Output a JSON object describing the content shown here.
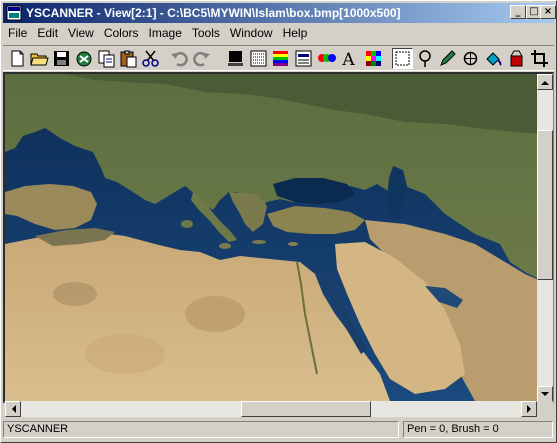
{
  "window": {
    "title": "YSCANNER - View[2:1] - C:\\BC5\\MYWIN\\Islam\\box.bmp[1000x500]",
    "app_icon": "app-icon",
    "controls": {
      "minimize": "_",
      "maximize": "□",
      "close": "×"
    }
  },
  "menu": {
    "items": [
      {
        "label": "File"
      },
      {
        "label": "Edit"
      },
      {
        "label": "View"
      },
      {
        "label": "Colors"
      },
      {
        "label": "Image"
      },
      {
        "label": "Tools"
      },
      {
        "label": "Window"
      },
      {
        "label": "Help"
      }
    ]
  },
  "toolbar": {
    "buttons": [
      {
        "name": "new-file-icon"
      },
      {
        "name": "open-folder-icon"
      },
      {
        "name": "save-disk-icon"
      },
      {
        "name": "scan-icon"
      },
      {
        "name": "copy-icon"
      },
      {
        "name": "paste-icon"
      },
      {
        "name": "cut-icon"
      },
      {
        "name": "undo-icon"
      },
      {
        "name": "redo-icon"
      },
      {
        "name": "display-icon"
      },
      {
        "name": "histogram-icon"
      },
      {
        "name": "palette-bars-icon"
      },
      {
        "name": "filter-icon"
      },
      {
        "name": "rgb-icon"
      },
      {
        "name": "text-icon",
        "text": "A"
      },
      {
        "name": "grid-colors-icon"
      },
      {
        "name": "select-rect-icon"
      },
      {
        "name": "lasso-icon"
      },
      {
        "name": "pencil-icon"
      },
      {
        "name": "circle-icon"
      },
      {
        "name": "fill-bucket-icon"
      },
      {
        "name": "paint-can-icon"
      },
      {
        "name": "crop-icon"
      }
    ]
  },
  "view": {
    "image_name": "box.bmp",
    "zoom": "2:1",
    "image_size": "1000x500"
  },
  "statusbar": {
    "app_label": "YSCANNER",
    "pen_brush": "Pen = 0,  Brush = 0"
  },
  "colors": {
    "titlebar_start": "#0a246a",
    "titlebar_end": "#a6caf0",
    "face": "#d4d0c8"
  }
}
